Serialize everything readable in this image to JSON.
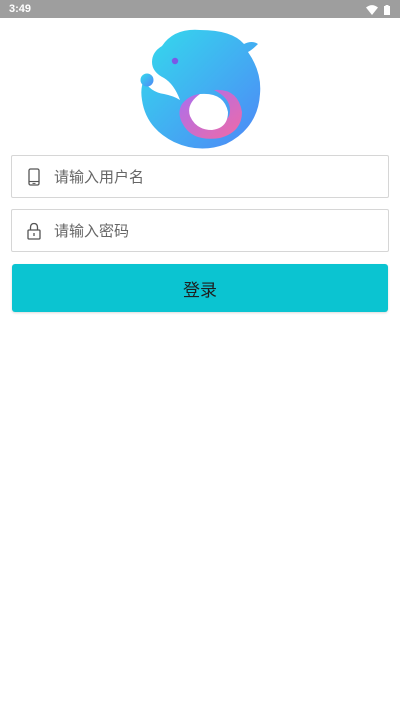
{
  "status_bar": {
    "time": "3:49",
    "icons": [
      "wifi-icon",
      "battery-icon"
    ]
  },
  "logo": {
    "icon": "dolphin-logo-icon",
    "colors": {
      "gradient_start": "#33dcec",
      "gradient_end": "#4f86f7",
      "accent_pink": "#f06aa6",
      "accent_purple": "#a86ff0"
    }
  },
  "login_form": {
    "username": {
      "icon": "phone-icon",
      "value": "",
      "placeholder": "请输入用户名"
    },
    "password": {
      "icon": "lock-icon",
      "value": "",
      "placeholder": "请输入密码"
    },
    "submit_label": "登录"
  },
  "colors": {
    "status_bar_bg": "#9e9e9e",
    "button_bg": "#0bc4d1",
    "field_border": "#d6d6d6"
  }
}
